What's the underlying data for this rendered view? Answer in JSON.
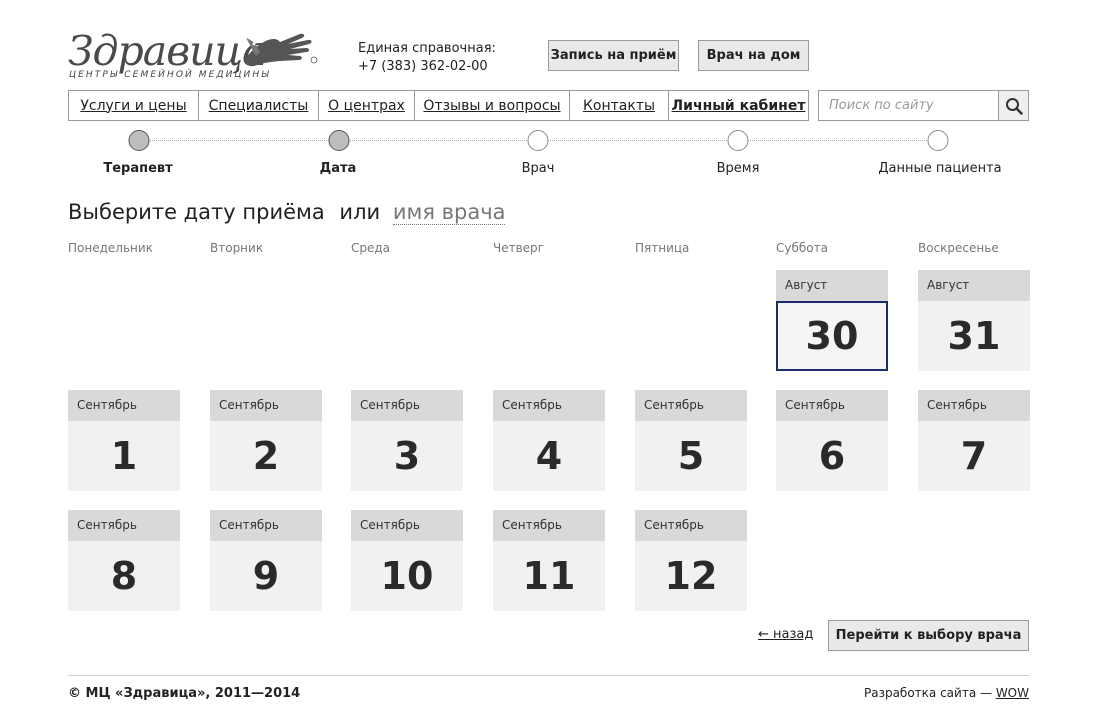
{
  "logo": {
    "name": "Здравица",
    "tagline": "ЦЕНТРЫ СЕМЕЙНОЙ МЕДИЦИНЫ",
    "icon": "hand-bird-logo-icon"
  },
  "contact": {
    "label": "Единая справочная:",
    "phone": "+7 (383) 362-02-00"
  },
  "header_buttons": {
    "appointment": "Запись на приём",
    "home_visit": "Врач на дом"
  },
  "nav": [
    {
      "label": "Услуги и цены"
    },
    {
      "label": "Специалисты"
    },
    {
      "label": "О центрах"
    },
    {
      "label": "Отзывы и вопросы"
    },
    {
      "label": "Контакты"
    },
    {
      "label": "Личный кабинет"
    }
  ],
  "search": {
    "placeholder": "Поиск по сайту",
    "icon": "search-icon"
  },
  "steps": [
    {
      "label": "Терапевт",
      "state": "done"
    },
    {
      "label": "Дата",
      "state": "current"
    },
    {
      "label": "Врач",
      "state": "pending"
    },
    {
      "label": "Время",
      "state": "pending"
    },
    {
      "label": "Данные пациента",
      "state": "pending"
    }
  ],
  "heading": {
    "main": "Выберите дату приёма",
    "or": "или",
    "alt": "имя врача"
  },
  "weekdays": [
    "Понедельник",
    "Вторник",
    "Среда",
    "Четверг",
    "Пятница",
    "Суббота",
    "Воскресенье"
  ],
  "calendar": [
    {
      "month": "Август",
      "day": "30",
      "selected": true
    },
    {
      "month": "Август",
      "day": "31",
      "selected": false
    },
    {
      "month": "Сентябрь",
      "day": "1",
      "selected": false
    },
    {
      "month": "Сентябрь",
      "day": "2",
      "selected": false
    },
    {
      "month": "Сентябрь",
      "day": "3",
      "selected": false
    },
    {
      "month": "Сентябрь",
      "day": "4",
      "selected": false
    },
    {
      "month": "Сентябрь",
      "day": "5",
      "selected": false
    },
    {
      "month": "Сентябрь",
      "day": "6",
      "selected": false
    },
    {
      "month": "Сентябрь",
      "day": "7",
      "selected": false
    },
    {
      "month": "Сентябрь",
      "day": "8",
      "selected": false
    },
    {
      "month": "Сентябрь",
      "day": "9",
      "selected": false
    },
    {
      "month": "Сентябрь",
      "day": "10",
      "selected": false
    },
    {
      "month": "Сентябрь",
      "day": "11",
      "selected": false
    },
    {
      "month": "Сентябрь",
      "day": "12",
      "selected": false
    }
  ],
  "actions": {
    "back": "← назад",
    "next": "Перейти к выбору врача"
  },
  "footer": {
    "copyright": "© МЦ «Здравица», 2011—2014",
    "dev_label": "Разработка сайта —",
    "dev_link": "WOW"
  },
  "colors": {
    "selected_border": "#1e2a6e",
    "card_header": "#d9d9d9",
    "card_body": "#f1f1f1"
  }
}
